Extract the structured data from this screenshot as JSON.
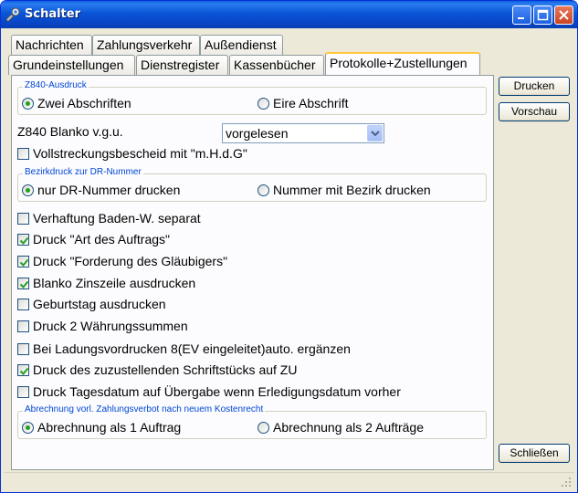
{
  "window": {
    "title": "Schalter"
  },
  "tabs": {
    "row1": [
      "Nachrichten",
      "Zahlungsverkehr",
      "Außendienst"
    ],
    "row2": [
      "Grundeinstellungen",
      "Dienstregister",
      "Kassenbücher",
      "Protokolle+Zustellungen"
    ],
    "active": "Protokolle+Zustellungen"
  },
  "z840_group": {
    "legend": "Z840-Ausdruck",
    "options": [
      {
        "label": "Zwei Abschriften",
        "selected": true
      },
      {
        "label": "Eire Abschrift",
        "selected": false
      }
    ]
  },
  "blanko": {
    "label": "Z840 Blanko v.g.u.",
    "value": "vorgelesen"
  },
  "vollstreckung": {
    "label": "Vollstreckungsbescheid mit \"m.H.d.G\"",
    "checked": false
  },
  "bezirk_group": {
    "legend": "Bezirkdruck zur DR-Nummer",
    "options": [
      {
        "label": "nur DR-Nummer drucken",
        "selected": true
      },
      {
        "label": "Nummer mit Bezirk drucken",
        "selected": false
      }
    ]
  },
  "checkboxes": [
    {
      "label": "Verhaftung Baden-W. separat",
      "checked": false
    },
    {
      "label": "Druck \"Art des Auftrags\"",
      "checked": true
    },
    {
      "label": "Druck \"Forderung des Gläubigers\"",
      "checked": true
    },
    {
      "label": "Blanko Zinszeile ausdrucken",
      "checked": true
    },
    {
      "label": "Geburtstag ausdrucken",
      "checked": false
    },
    {
      "label": "Druck 2 Währungssummen",
      "checked": false
    },
    {
      "label": "Bei Ladungsvordrucken 8(EV eingeleitet)auto. ergänzen",
      "checked": false
    },
    {
      "label": "Druck des zuzustellenden Schriftstücks auf ZU",
      "checked": true
    },
    {
      "label": "Druck Tagesdatum auf Übergabe wenn Erledigungsdatum vorher",
      "checked": false
    }
  ],
  "abrechnung_group": {
    "legend": "Abrechnung vorl. Zahlungsverbot nach neuem Kostenrecht",
    "options": [
      {
        "label": "Abrechnung als 1 Auftrag",
        "selected": true
      },
      {
        "label": "Abrechnung als 2 Aufträge",
        "selected": false
      }
    ]
  },
  "buttons": {
    "print": "Drucken",
    "preview": "Vorschau",
    "close": "Schließen"
  },
  "colors": {
    "accent_title": "#0a55d6",
    "legend": "#0046d5",
    "radio_dot": "#21a121",
    "check_mark": "#21a121"
  }
}
